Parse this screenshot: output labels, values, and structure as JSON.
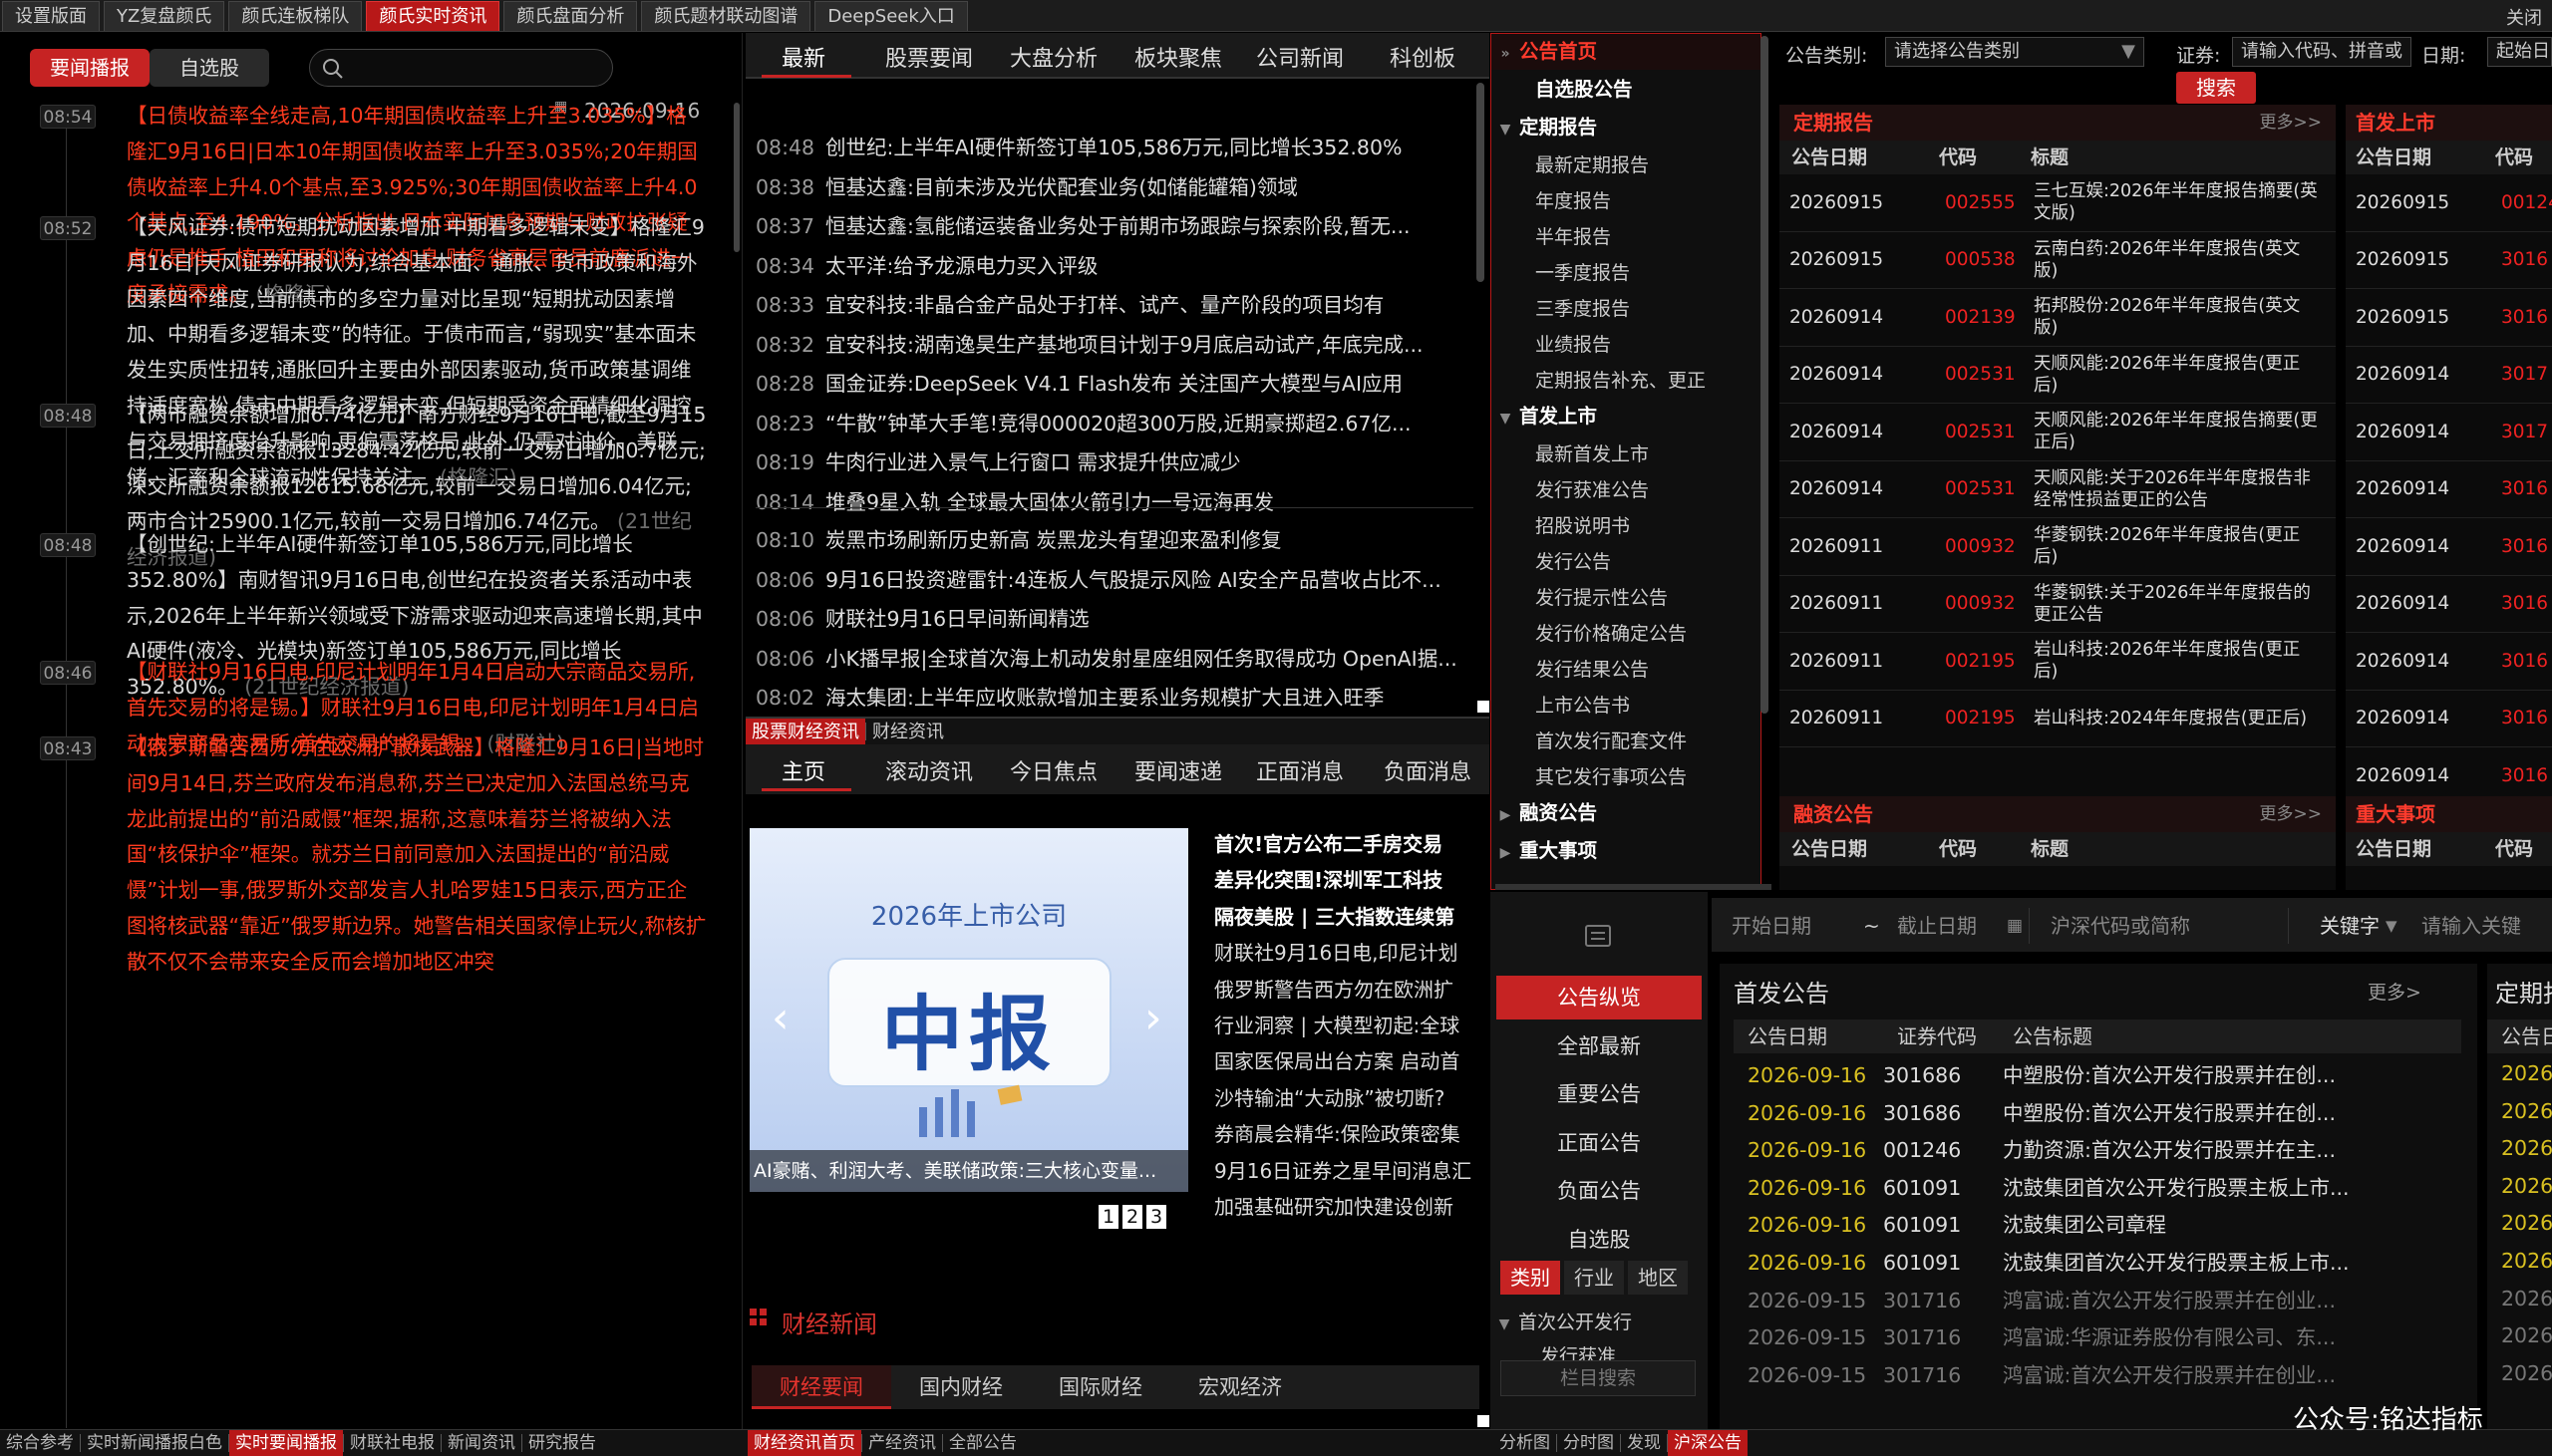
{
  "top_tabs": [
    "设置版面",
    "YZ复盘颜氏",
    "颜氏连板梯队",
    "颜氏实时资讯",
    "颜氏盘面分析",
    "颜氏题材联动图谱",
    "DeepSeek入口"
  ],
  "top_active": 3,
  "top_close": "关闭",
  "p1": {
    "tab_news": "要闻播报",
    "tab_watch": "自选股",
    "date": "2026-09-16",
    "items": [
      {
        "time": "08:54",
        "red": true,
        "text": "【日债收益率全线走高,10年期国债收益率上升至3.035%】格隆汇9月16日|日本10年期国债收益率上升至3.035%;20年期国债收益率上升4.0个基点,至3.925%;30年期国债收益率上升4.0个基点,至4.190%。分析指出,日本实际加息预期与财政扩张疑虑仍是推手,植田和男称将讨论加息,财务省高层官员前鹿派进一度承接需求。",
        "src": "(格隆汇)"
      },
      {
        "time": "08:52",
        "red": false,
        "text": "【天风证券:债市短期扰动因素增加 中期看多逻辑未变】格隆汇9月16日|天风证券研报认为,综合基本面、通胀、货币政策和海外因素四个维度,当前债市的多空力量对比呈现“短期扰动因素增加、中期看多逻辑未变”的特征。于债市而言,“弱现实”基本面未发生实质性扭转,通胀回升主要由外部因素驱动,货币政策基调维持适度宽松,债市中期看多逻辑未变,但短期受资金面精细化调控与交易拥挤度抬升影响,更偏震荡格局,此外,仍需对油价、美联储、汇率和全球流动性保持关注。",
        "src": "(格隆汇)"
      },
      {
        "time": "08:48",
        "red": false,
        "text": "【两市融资余额增加6.74亿元】南方财经9月16日电,截至9月15日,上交所融资余额报13284.42亿元,较前一交易日增加0.7亿元;深交所融资余额报12615.68亿元,较前一交易日增加6.04亿元;两市合计25900.1亿元,较前一交易日增加6.74亿元。",
        "src": "(21世纪经济报道)"
      },
      {
        "time": "08:48",
        "red": false,
        "text": "【创世纪:上半年AI硬件新签订单105,586万元,同比增长352.80%】南财智讯9月16日电,创世纪在投资者关系活动中表示,2026年上半年新兴领域受下游需求驱动迎来高速增长期,其中AI硬件(液冷、光模块)新签订单105,586万元,同比增长352.80%。",
        "src": "(21世纪经济报道)"
      },
      {
        "time": "08:46",
        "red": true,
        "text": "【财联社9月16日电,印尼计划明年1月4日启动大宗商品交易所,首先交易的将是锡。】财联社9月16日电,印尼计划明年1月4日启动大宗商品交易所,首先交易的将是锡。",
        "src": "(财联社)"
      },
      {
        "time": "08:43",
        "red": true,
        "text": "【俄罗斯警告西方勿在欧洲扩散核武器】格隆汇9月16日|当地时间9月14日,芬兰政府发布消息称,芬兰已决定加入法国总统马克龙此前提出的“前沿威慑”框架,据称,这意味着芬兰将被纳入法国“核保护伞”框架。就芬兰日前同意加入法国提出的“前沿威慑”计划一事,俄罗斯外交部发言人扎哈罗娃15日表示,西方正企图将核武器“靠近”俄罗斯边界。她警告相关国家停止玩火,称核扩散不仅不会带来安全反而会增加地区冲突",
        "src": ""
      }
    ]
  },
  "p2": {
    "tabs": [
      "最新",
      "股票要闻",
      "大盘分析",
      "板块聚焦",
      "公司新闻",
      "科创板"
    ],
    "list_top": [
      {
        "time": "08:48",
        "title": "创世纪:上半年AI硬件新签订单105,586万元,同比增长352.80%"
      },
      {
        "time": "08:38",
        "title": "恒基达鑫:目前未涉及光伏配套业务(如储能罐箱)领域"
      },
      {
        "time": "08:37",
        "title": "恒基达鑫:氢能储运装备业务处于前期市场跟踪与探索阶段,暂无..."
      },
      {
        "time": "08:34",
        "title": "太平洋:给予龙源电力买入评级"
      },
      {
        "time": "08:33",
        "title": "宜安科技:非晶合金产品处于打样、试产、量产阶段的项目均有"
      },
      {
        "time": "08:32",
        "title": "宜安科技:湖南逸昊生产基地项目计划于9月底启动试产,年底完成..."
      },
      {
        "time": "08:28",
        "title": "国金证券:DeepSeek V4.1 Flash发布 关注国产大模型与AI应用"
      },
      {
        "time": "08:23",
        "title": "“牛散”钟革大手笔!竞得000020超300万股,近期豪掷超2.67亿..."
      },
      {
        "time": "08:19",
        "title": "牛肉行业进入景气上行窗口 需求提升供应减少"
      },
      {
        "time": "08:14",
        "title": "堆叠9星入轨 全球最大固体火箭引力一号远海再发"
      }
    ],
    "list_bottom": [
      {
        "time": "08:10",
        "title": "炭黑市场刷新历史新高 炭黑龙头有望迎来盈利修复"
      },
      {
        "time": "08:06",
        "title": "9月16日投资避雷针:4连板人气股提示风险 AI安全产品营收占比不..."
      },
      {
        "time": "08:06",
        "title": "财联社9月16日早间新闻精选"
      },
      {
        "time": "08:06",
        "title": "小K播早报|全球首次海上机动发射星座组网任务取得成功 OpenAI据..."
      },
      {
        "time": "08:02",
        "title": "海太集团:上半年应收账款增加主要系业务规模扩大且进入旺季"
      }
    ],
    "section_tabs": [
      "股票财经资讯",
      "财经资讯"
    ],
    "tabs2": [
      "主页",
      "滚动资讯",
      "今日焦点",
      "要闻速递",
      "正面消息",
      "负面消息"
    ],
    "promo_title": "2026年上市公司",
    "promo_big": "中报",
    "promo_caption": "AI豪赌、利润大考、美联储政策:三大核心变量...",
    "pages": [
      "1",
      "2",
      "3"
    ],
    "headlines": [
      {
        "text": "首次!官方公布二手房交易",
        "bold": true
      },
      {
        "text": "差异化突围!深圳军工科技",
        "bold": true
      },
      {
        "text": "隔夜美股 | 三大指数连续第",
        "bold": true
      },
      {
        "text": "财联社9月16日电,印尼计划",
        "bold": false
      },
      {
        "text": "俄罗斯警告西方勿在欧洲扩",
        "bold": false
      },
      {
        "text": "行业洞察 | 大模型初起:全球",
        "bold": false
      },
      {
        "text": "国家医保局出台方案 启动首",
        "bold": false
      },
      {
        "text": "沙特输油“大动脉”被切断?",
        "bold": false
      },
      {
        "text": "券商晨会精华:保险政策密集",
        "bold": false
      },
      {
        "text": "9月16日证券之星早间消息汇",
        "bold": false
      },
      {
        "text": "加强基础研究加快建设创新",
        "bold": false
      }
    ],
    "caijing_title": "财经新闻",
    "caijing_tabs": [
      "财经要闻",
      "国内财经",
      "国际财经",
      "宏观经济"
    ]
  },
  "p3": {
    "items": [
      {
        "label": "公告首页",
        "level": "top",
        "arrow": "»"
      },
      {
        "label": "自选股公告",
        "level": "h",
        "arrow": ""
      },
      {
        "label": "定期报告",
        "level": "h",
        "arrow": "▼"
      },
      {
        "label": "最新定期报告",
        "level": "c",
        "arrow": ""
      },
      {
        "label": "年度报告",
        "level": "c",
        "arrow": ""
      },
      {
        "label": "半年报告",
        "level": "c",
        "arrow": ""
      },
      {
        "label": "一季度报告",
        "level": "c",
        "arrow": ""
      },
      {
        "label": "三季度报告",
        "level": "c",
        "arrow": ""
      },
      {
        "label": "业绩报告",
        "level": "c",
        "arrow": ""
      },
      {
        "label": "定期报告补充、更正",
        "level": "c",
        "arrow": ""
      },
      {
        "label": "首发上市",
        "level": "h",
        "arrow": "▼"
      },
      {
        "label": "最新首发上市",
        "level": "c",
        "arrow": ""
      },
      {
        "label": "发行获准公告",
        "level": "c",
        "arrow": ""
      },
      {
        "label": "招股说明书",
        "level": "c",
        "arrow": ""
      },
      {
        "label": "发行公告",
        "level": "c",
        "arrow": ""
      },
      {
        "label": "发行提示性公告",
        "level": "c",
        "arrow": ""
      },
      {
        "label": "发行价格确定公告",
        "level": "c",
        "arrow": ""
      },
      {
        "label": "发行结果公告",
        "level": "c",
        "arrow": ""
      },
      {
        "label": "上市公告书",
        "level": "c",
        "arrow": ""
      },
      {
        "label": "首次发行配套文件",
        "level": "c",
        "arrow": ""
      },
      {
        "label": "其它发行事项公告",
        "level": "c",
        "arrow": ""
      },
      {
        "label": "融资公告",
        "level": "h",
        "arrow": "▶"
      },
      {
        "label": "重大事项",
        "level": "h",
        "arrow": "▶"
      }
    ]
  },
  "p4": {
    "lbl_type": "公告类别:",
    "sel_type": "请选择公告类别",
    "lbl_sec": "证券:",
    "sel_sec": "请输入代码、拼音或",
    "lbl_date": "日期:",
    "sel_date": "起始日",
    "search_btn": "搜索",
    "periodic": {
      "title": "定期报告",
      "more": "更多>>",
      "cols": [
        "公告日期",
        "代码",
        "标题"
      ],
      "rows": [
        [
          "20260915",
          "002555",
          "三七互娱:2026年半年度报告摘要(英文版)"
        ],
        [
          "20260915",
          "000538",
          "云南白药:2026年半年度报告(英文版)"
        ],
        [
          "20260914",
          "002139",
          "拓邦股份:2026年半年度报告(英文版)"
        ],
        [
          "20260914",
          "002531",
          "天顺风能:2026年半年度报告(更正后)"
        ],
        [
          "20260914",
          "002531",
          "天顺风能:2026年半年度报告摘要(更正后)"
        ],
        [
          "20260914",
          "002531",
          "天顺风能:关于2026年半年度报告非经常性损益更正的公告"
        ],
        [
          "20260911",
          "000932",
          "华菱钢铁:2026年半年度报告(更正后)"
        ],
        [
          "20260911",
          "000932",
          "华菱钢铁:关于2026年半年度报告的更正公告"
        ],
        [
          "20260911",
          "002195",
          "岩山科技:2026年半年度报告(更正后)"
        ],
        [
          "20260911",
          "002195",
          "岩山科技:2024年年度报告(更正后)"
        ]
      ]
    },
    "ipo": {
      "title": "首发上市",
      "cols": [
        "公告日期",
        "代码"
      ],
      "rows": [
        [
          "20260915",
          "00124"
        ],
        [
          "20260915",
          "3016"
        ],
        [
          "20260915",
          "3016"
        ],
        [
          "20260914",
          "3017"
        ],
        [
          "20260914",
          "3017"
        ],
        [
          "20260914",
          "3016"
        ],
        [
          "20260914",
          "3016"
        ],
        [
          "20260914",
          "3016"
        ],
        [
          "20260914",
          "3016"
        ],
        [
          "20260914",
          "3016"
        ],
        [
          "20260914",
          "3016"
        ]
      ]
    },
    "finance": {
      "title": "融资公告",
      "more": "更多>>",
      "cols": [
        "公告日期",
        "代码",
        "标题"
      ]
    },
    "major": {
      "title": "重大事项",
      "cols": [
        "公告日期",
        "代码"
      ]
    }
  },
  "p5": {
    "side": [
      "公告纵览",
      "全部最新",
      "重要公告",
      "正面公告",
      "负面公告",
      "自选股"
    ],
    "side_active": 0,
    "chips": [
      "类别",
      "行业",
      "地区"
    ],
    "tree": [
      {
        "label": "首次公开发行",
        "arrow": "▼"
      },
      {
        "label": "发行获准",
        "arrow": ""
      }
    ],
    "tree_search": "栏目搜索",
    "start": "开始日期",
    "tilde": "~",
    "end": "截止日期",
    "code_ph": "沪深代码或简称",
    "kw": "关键字",
    "kw_ph": "请输入关键",
    "title": "首发公告",
    "more": "更多>",
    "cols": [
      "公告日期",
      "证券代码",
      "公告标题"
    ],
    "rows": [
      {
        "d": "2026-09-16",
        "c": "301686",
        "t": "中塑股份:首次公开发行股票并在创...",
        "grey": false
      },
      {
        "d": "2026-09-16",
        "c": "301686",
        "t": "中塑股份:首次公开发行股票并在创...",
        "grey": false
      },
      {
        "d": "2026-09-16",
        "c": "001246",
        "t": "力勤资源:首次公开发行股票并在主...",
        "grey": false
      },
      {
        "d": "2026-09-16",
        "c": "601091",
        "t": "沈鼓集团首次公开发行股票主板上市...",
        "grey": false
      },
      {
        "d": "2026-09-16",
        "c": "601091",
        "t": "沈鼓集团公司章程",
        "grey": false
      },
      {
        "d": "2026-09-16",
        "c": "601091",
        "t": "沈鼓集团首次公开发行股票主板上市...",
        "grey": false
      },
      {
        "d": "2026-09-15",
        "c": "301716",
        "t": "鸿富诚:首次公开发行股票并在创业...",
        "grey": true
      },
      {
        "d": "2026-09-15",
        "c": "301716",
        "t": "鸿富诚:华源证券股份有限公司、东...",
        "grey": true
      },
      {
        "d": "2026-09-15",
        "c": "301716",
        "t": "鸿富诚:首次公开发行股票并在创业...",
        "grey": true
      }
    ],
    "right_title": "定期报告",
    "right_col": "公告日",
    "right_dates": [
      "2026-",
      "2026-",
      "2026-",
      "2026-",
      "2026-",
      "2026-",
      "2026-",
      "2026-",
      "2026-"
    ]
  },
  "bottom_left": [
    "综合参考",
    "实时新闻播报白色",
    "实时要闻播报",
    "财联社电报",
    "新闻资讯",
    "研究报告"
  ],
  "bottom_left_active": 2,
  "bottom_mid": [
    "财经资讯首页",
    "产经资讯",
    "全部公告"
  ],
  "bottom_mid_active": 0,
  "bottom_right": [
    "分析图",
    "分时图",
    "发现",
    "沪深公告"
  ],
  "bottom_right_active": 3,
  "watermark": "公众号:铭达指标"
}
